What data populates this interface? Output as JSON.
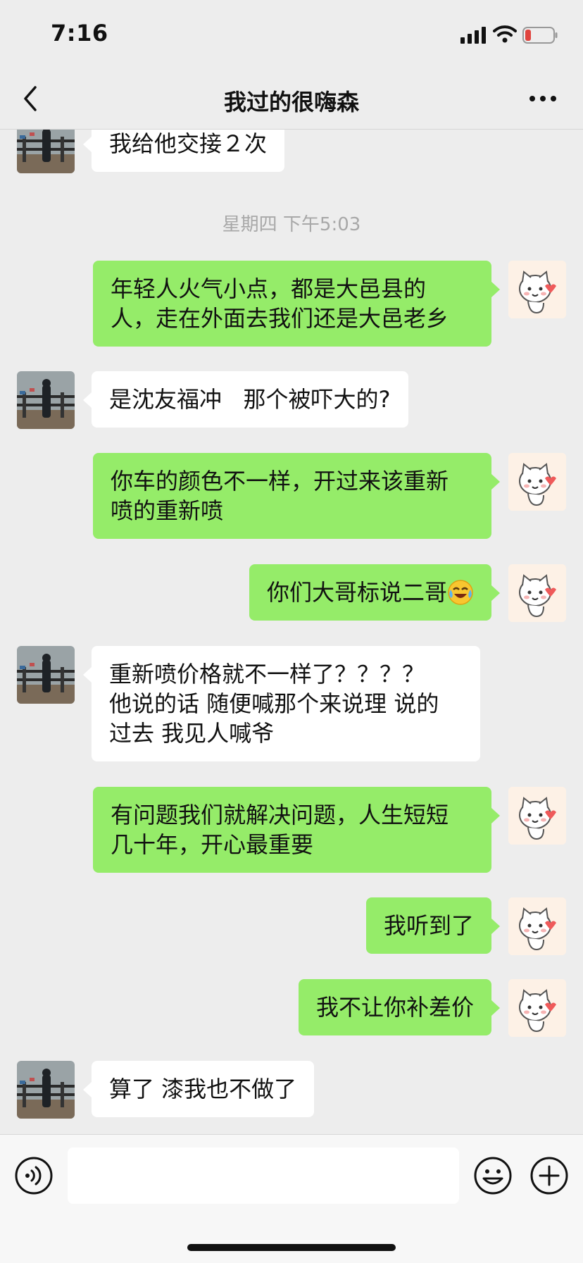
{
  "status": {
    "time": "7:16"
  },
  "nav": {
    "title": "我过的很嗨森"
  },
  "chat": {
    "timestamp": "星期四 下午5:03",
    "messages": [
      {
        "side": "in",
        "text": "我给他交接２次"
      },
      {
        "side": "out",
        "text": "年轻人火气小点，都是大邑县的\n人，走在外面去我们还是大邑老乡"
      },
      {
        "side": "in",
        "text": "是沈友福冲   那个被吓大的?"
      },
      {
        "side": "out",
        "text": "你车的颜色不一样，开过来该重新\n喷的重新喷"
      },
      {
        "side": "out",
        "text": "你们大哥标说二哥",
        "emoji": "laughing-crying-emoji"
      },
      {
        "side": "in",
        "text": "重新喷价格就不一样了？？？？\n他说的话 随便喊那个来说理 说的\n过去 我见人喊爷"
      },
      {
        "side": "out",
        "text": "有问题我们就解决问题，人生短短\n几十年，开心最重要"
      },
      {
        "side": "out",
        "text": "我听到了"
      },
      {
        "side": "out",
        "text": "我不让你补差价"
      },
      {
        "side": "in",
        "text": "算了 漆我也不做了"
      }
    ]
  },
  "input": {
    "value": ""
  },
  "icons": {
    "back": "chevron-left-icon",
    "more": "more-dots-icon",
    "voice": "voice-icon",
    "emoji": "emoji-icon",
    "plus": "plus-icon"
  },
  "colors": {
    "outgoing_bubble": "#95ec69",
    "incoming_bubble": "#ffffff",
    "background": "#ededed",
    "battery_low": "#e0443e"
  }
}
